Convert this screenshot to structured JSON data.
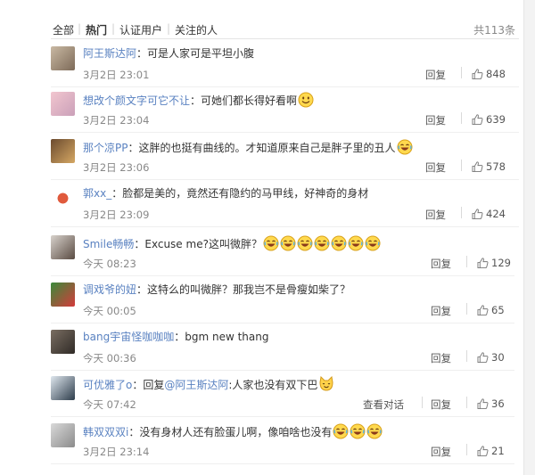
{
  "filters": {
    "tabs": [
      {
        "label": "全部"
      },
      {
        "label": "热门",
        "active": true
      },
      {
        "label": "认证用户"
      },
      {
        "label": "关注的人"
      }
    ],
    "total": "共113条"
  },
  "comments": [
    {
      "user": "阿王斯达阿",
      "text": "可是人家可是平坦小腹",
      "time": "3月2日 23:01",
      "reply": "回复",
      "likes": "848",
      "emojis": []
    },
    {
      "user": "想改个颜文字可它不让",
      "text": "可她们都长得好看啊",
      "time": "3月2日 23:04",
      "reply": "回复",
      "likes": "639",
      "emojis": [
        "smile"
      ]
    },
    {
      "user": "那个凉PP",
      "text": "这胖的也挺有曲线的。才知道原来自己是胖子里的丑人",
      "time": "3月2日 23:06",
      "reply": "回复",
      "likes": "578",
      "emojis": [
        "laugh"
      ]
    },
    {
      "user": "郭xx_",
      "text": "脸都是美的，竟然还有隐约的马甲线，好神奇的身材",
      "time": "3月2日 23:09",
      "reply": "回复",
      "likes": "424",
      "emojis": []
    },
    {
      "user": "Smile畅畅",
      "text": "Excuse me?这叫微胖？",
      "time": "今天 08:23",
      "reply": "回复",
      "likes": "129",
      "emojis": [
        "laugh",
        "laugh",
        "laugh",
        "laugh",
        "laugh",
        "laugh",
        "laugh"
      ]
    },
    {
      "user": "调戏爷的妞",
      "text": "这特么的叫微胖？那我岂不是骨瘦如柴了？",
      "time": "今天 00:05",
      "reply": "回复",
      "likes": "65",
      "emojis": []
    },
    {
      "user": "bang宇宙怪咖咖咖",
      "text": "bgm new thang",
      "time": "今天 00:36",
      "reply": "回复",
      "likes": "30",
      "emojis": []
    },
    {
      "user": "可优雅了o",
      "reply_prefix": "回复",
      "reply_target": "@阿王斯达阿",
      "text": ":人家也没有双下巴",
      "time": "今天 07:42",
      "view_dialog": "查看对话",
      "reply": "回复",
      "likes": "36",
      "emojis": [
        "cat"
      ]
    },
    {
      "user": "韩双双双i",
      "text": "没有身材人还有脸蛋儿啊，像咱啥也没有",
      "time": "3月2日 23:14",
      "reply": "回复",
      "likes": "21",
      "emojis": [
        "laugh",
        "laugh",
        "laugh"
      ]
    }
  ],
  "icons": {
    "thumb": "thumbs-up-icon",
    "laugh": "laughing-emoji-icon",
    "smile": "smile-emoji-icon",
    "cat": "cat-emoji-icon"
  },
  "colors": {
    "link": "#5a82c1",
    "muted": "#888888",
    "divider": "#efefef"
  }
}
